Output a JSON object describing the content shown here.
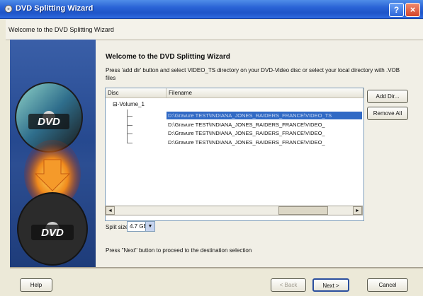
{
  "window": {
    "title": "DVD Splitting Wizard",
    "help_button": "?",
    "close_button": "×"
  },
  "header": {
    "text": "Welcome to the DVD Splitting Wizard"
  },
  "content": {
    "title": "Welcome to the DVD Splitting Wizard",
    "description": "Press 'add dir' button and select VIDEO_TS directory on your DVD-Video disc or select your local directory with .VOB files"
  },
  "list": {
    "columns": [
      "Disc",
      "Filename"
    ],
    "tree_root": "⊟-Volume_1",
    "rows": [
      "D:\\Gravure TEST\\INDIANA_JONES_RAIDERS_FRANCE\\VIDEO_TS",
      "D:\\Gravure TEST\\INDIANA_JONES_RAIDERS_FRANCE\\VIDEO_",
      "D:\\Gravure TEST\\INDIANA_JONES_RAIDERS_FRANCE\\VIDEO_",
      "D:\\Gravure TEST\\INDIANA_JONES_RAIDERS_FRANCE\\VIDEO_"
    ],
    "selected_row": 0
  },
  "buttons": {
    "add_dir": "Add Dir...",
    "remove_all": "Remove All",
    "help": "Help",
    "back": "< Back",
    "next": "Next >",
    "cancel": "Cancel"
  },
  "split": {
    "label": "Split size",
    "value": "4.7 GB"
  },
  "footer": {
    "text": "Press \"Next\" button to proceed to the destination selection"
  },
  "icons": {
    "side_top": "dvd-disc-icon",
    "side_arrow": "arrow-down-icon",
    "side_bottom": "dvd-disc-icon",
    "title": "dvd-app-icon"
  },
  "colors": {
    "titlebar": "#2a63d6",
    "selection": "#316ac5",
    "sidepanel": "#26498f"
  }
}
